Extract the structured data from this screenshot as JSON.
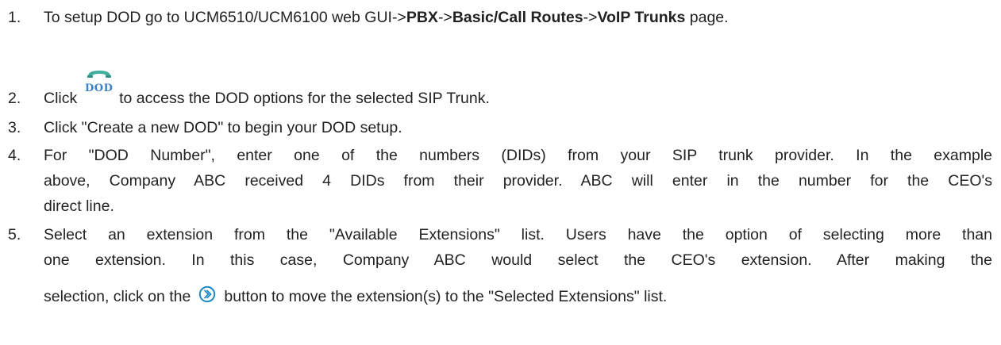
{
  "steps": [
    {
      "num": "1.",
      "t1": "To setup DOD go to UCM6510/UCM6100 web GUI->",
      "b1": "PBX",
      "t2": "->",
      "b2": "Basic/Call Routes",
      "t3": "->",
      "b3": "VoIP Trunks",
      "t4": " page."
    },
    {
      "num": "2.",
      "before": "Click ",
      "icon_label": "DOD",
      "after": " to access the DOD options for the selected SIP Trunk."
    },
    {
      "num": "3.",
      "text": "Click \"Create a new DOD\" to begin your DOD setup."
    },
    {
      "num": "4.",
      "line1": "For \"DOD Number\", enter one of the numbers (DIDs) from your SIP trunk provider. In the example",
      "line2": "above, Company ABC received 4 DIDs from their provider. ABC will enter in the number for the CEO's",
      "line3": "direct line."
    },
    {
      "num": "5.",
      "line1": "Select an extension from the \"Available Extensions\" list. Users have the option of selecting more than",
      "line2": "one extension. In this case, Company ABC would select the CEO's extension. After making the",
      "line3_before": "selection, click on the",
      "line3_after": "button to move the extension(s) to the \"Selected Extensions\" list."
    }
  ],
  "icons": {
    "dod": "dod-phone-icon",
    "arrow": "right-arrow-circle-icon",
    "icon_color": "#3a82c4",
    "arrow_color": "#1e88c8"
  }
}
